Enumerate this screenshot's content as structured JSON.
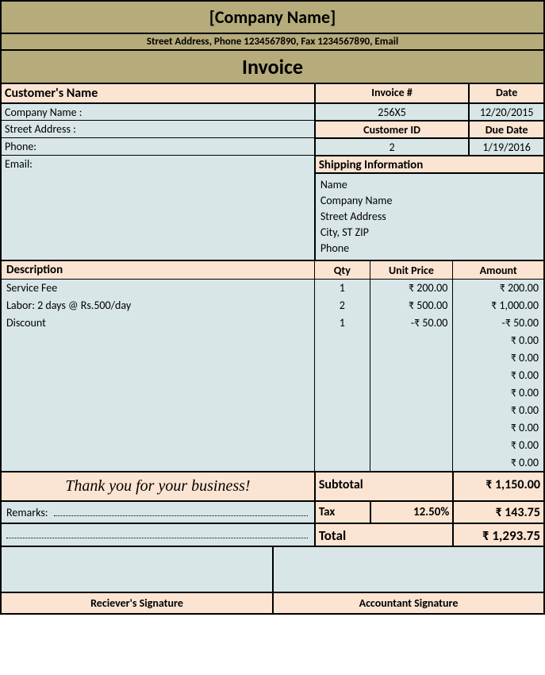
{
  "header": {
    "company_name": "[Company Name]",
    "address_line": "Street Address, Phone 1234567890, Fax 1234567890, Email",
    "invoice_title": "Invoice"
  },
  "customer": {
    "heading": "Customer's Name",
    "company_label": "Company Name :",
    "street_label": "Street Address :",
    "phone_label": "Phone:",
    "email_label": "Email:"
  },
  "invoice_meta": {
    "invoice_num_label": "Invoice #",
    "invoice_num": "256X5",
    "date_label": "Date",
    "date": "12/20/2015",
    "customer_id_label": "Customer ID",
    "customer_id": "2",
    "due_date_label": "Due Date",
    "due_date": "1/19/2016"
  },
  "shipping": {
    "heading": "Shipping Information",
    "name": "Name",
    "company": "Company Name",
    "street": "Street Address",
    "city": "City, ST ZIP",
    "phone": "Phone"
  },
  "items_headers": {
    "description": "Description",
    "qty": "Qty",
    "unit_price": "Unit Price",
    "amount": "Amount"
  },
  "items": [
    {
      "desc": "Service Fee",
      "qty": "1",
      "unit": "₹ 200.00",
      "amount": "₹ 200.00"
    },
    {
      "desc": "Labor: 2 days @ Rs.500/day",
      "qty": "2",
      "unit": "₹ 500.00",
      "amount": "₹ 1,000.00"
    },
    {
      "desc": "Discount",
      "qty": "1",
      "unit": "-₹ 50.00",
      "amount": "-₹ 50.00"
    },
    {
      "desc": "",
      "qty": "",
      "unit": "",
      "amount": "₹ 0.00"
    },
    {
      "desc": "",
      "qty": "",
      "unit": "",
      "amount": "₹ 0.00"
    },
    {
      "desc": "",
      "qty": "",
      "unit": "",
      "amount": "₹ 0.00"
    },
    {
      "desc": "",
      "qty": "",
      "unit": "",
      "amount": "₹ 0.00"
    },
    {
      "desc": "",
      "qty": "",
      "unit": "",
      "amount": "₹ 0.00"
    },
    {
      "desc": "",
      "qty": "",
      "unit": "",
      "amount": "₹ 0.00"
    },
    {
      "desc": "",
      "qty": "",
      "unit": "",
      "amount": "₹ 0.00"
    },
    {
      "desc": "",
      "qty": "",
      "unit": "",
      "amount": "₹ 0.00"
    }
  ],
  "totals": {
    "thankyou": "Thank you for your business!",
    "subtotal_label": "Subtotal",
    "subtotal": "₹ 1,150.00",
    "remarks_label": "Remarks:",
    "tax_label": "Tax",
    "tax_rate": "12.50%",
    "tax_amount": "₹ 143.75",
    "total_label": "Total",
    "total": "₹ 1,293.75"
  },
  "signatures": {
    "receiver": "Reciever's Signature",
    "accountant": "Accountant Signature"
  }
}
